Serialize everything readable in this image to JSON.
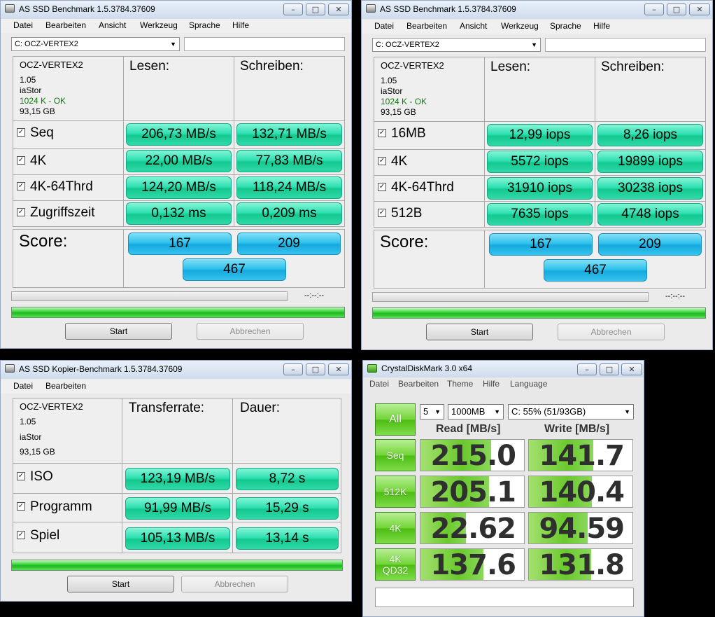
{
  "as_ssd_1": {
    "title": "AS SSD Benchmark 1.5.3784.37609",
    "menu": [
      "Datei",
      "Bearbeiten",
      "Ansicht",
      "Werkzeug",
      "Sprache",
      "Hilfe"
    ],
    "drive": "C: OCZ-VERTEX2",
    "info": {
      "model": "OCZ-VERTEX2",
      "firmware": "1.05",
      "driver": "iaStor",
      "alignment": "1024 K - OK",
      "size": "93,15 GB"
    },
    "col_read": "Lesen:",
    "col_write": "Schreiben:",
    "rows": [
      {
        "label": "Seq",
        "read": "206,73 MB/s",
        "write": "132,71 MB/s"
      },
      {
        "label": "4K",
        "read": "22,00 MB/s",
        "write": "77,83 MB/s"
      },
      {
        "label": "4K-64Thrd",
        "read": "124,20 MB/s",
        "write": "118,24 MB/s"
      },
      {
        "label": "Zugriffszeit",
        "read": "0,132 ms",
        "write": "0,209 ms"
      }
    ],
    "score_label": "Score:",
    "score_read": "167",
    "score_write": "209",
    "score_total": "467",
    "time": "--:--:--",
    "progress_done": 1.0,
    "btn_start": "Start",
    "btn_cancel": "Abbrechen"
  },
  "as_ssd_2": {
    "title": "AS SSD Benchmark 1.5.3784.37609",
    "menu": [
      "Datei",
      "Bearbeiten",
      "Ansicht",
      "Werkzeug",
      "Sprache",
      "Hilfe"
    ],
    "drive": "C: OCZ-VERTEX2",
    "info": {
      "model": "OCZ-VERTEX2",
      "firmware": "1.05",
      "driver": "iaStor",
      "alignment": "1024 K - OK",
      "size": "93,15 GB"
    },
    "col_read": "Lesen:",
    "col_write": "Schreiben:",
    "rows": [
      {
        "label": "16MB",
        "read": "12,99 iops",
        "write": "8,26 iops"
      },
      {
        "label": "4K",
        "read": "5572 iops",
        "write": "19899 iops"
      },
      {
        "label": "4K-64Thrd",
        "read": "31910 iops",
        "write": "30238 iops"
      },
      {
        "label": "512B",
        "read": "7635 iops",
        "write": "4748 iops"
      }
    ],
    "score_label": "Score:",
    "score_read": "167",
    "score_write": "209",
    "score_total": "467",
    "time": "--:--:--",
    "progress_done": 1.0,
    "btn_start": "Start",
    "btn_cancel": "Abbrechen"
  },
  "as_ssd_copy": {
    "title": "AS SSD Kopier-Benchmark 1.5.3784.37609",
    "menu": [
      "Datei",
      "Bearbeiten"
    ],
    "info": {
      "model": "OCZ-VERTEX2",
      "firmware": "1.05",
      "driver": "iaStor",
      "size": "93,15 GB"
    },
    "col_rate": "Transferrate:",
    "col_duration": "Dauer:",
    "rows": [
      {
        "label": "ISO",
        "rate": "123,19 MB/s",
        "duration": "8,72 s"
      },
      {
        "label": "Programm",
        "rate": "91,99 MB/s",
        "duration": "15,29 s"
      },
      {
        "label": "Spiel",
        "rate": "105,13 MB/s",
        "duration": "13,14 s"
      }
    ],
    "progress_done": 1.0,
    "btn_start": "Start",
    "btn_cancel": "Abbrechen"
  },
  "crystaldiskmark": {
    "title": "CrystalDiskMark 3.0 x64",
    "menu": [
      "Datei",
      "Bearbeiten",
      "Theme",
      "Hilfe",
      "Language"
    ],
    "all_label": "All",
    "count": "5",
    "size": "1000MB",
    "drive": "C: 55% (51/93GB)",
    "col_read": "Read [MB/s]",
    "col_write": "Write [MB/s]",
    "rows": [
      {
        "label": "Seq",
        "read": "215.0",
        "write": "141.7",
        "read_level": 0.68,
        "write_level": 0.62
      },
      {
        "label": "512K",
        "read": "205.1",
        "write": "140.4",
        "read_level": 0.66,
        "write_level": 0.61
      },
      {
        "label": "4K",
        "read": "22.62",
        "write": "94.59",
        "read_level": 0.44,
        "write_level": 0.57
      },
      {
        "label_line1": "4K",
        "label_line2": "QD32",
        "read": "137.6",
        "write": "131.8",
        "read_level": 0.61,
        "write_level": 0.6
      }
    ]
  }
}
